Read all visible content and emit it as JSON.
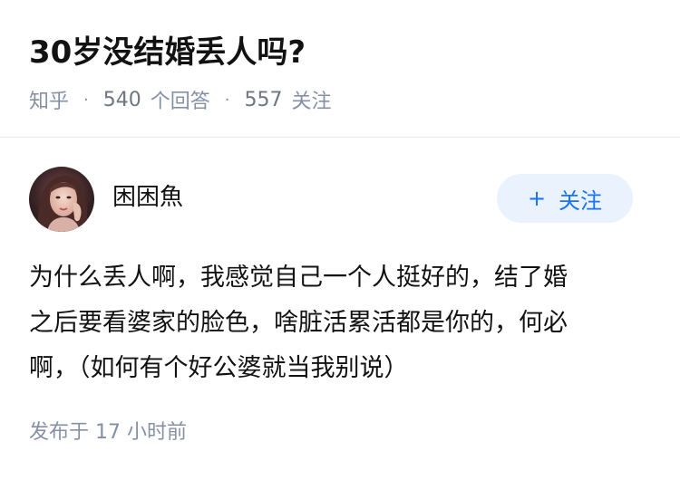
{
  "question": {
    "title": "30岁没结婚丢人吗?",
    "source": "知乎",
    "answer_count": "540",
    "answer_label": "个回答",
    "follow_count": "557",
    "follow_label": "关注",
    "separator": "·"
  },
  "answer": {
    "author_name": "困困魚",
    "follow_button_label": "关注",
    "follow_button_icon": "+",
    "content_lines": [
      "为什么丢人啊，我感觉自己一个人挺好的，结了婚",
      "之后要看婆家的脸色，啥脏活累活都是你的，何必",
      "啊，（如何有个好公婆就当我别说）"
    ],
    "post_time": "发布于 17 小时前"
  },
  "colors": {
    "accent": "#1772f6",
    "follow_bg": "#eaf2fd",
    "meta_text": "#8590a6",
    "primary_text": "#121212"
  }
}
